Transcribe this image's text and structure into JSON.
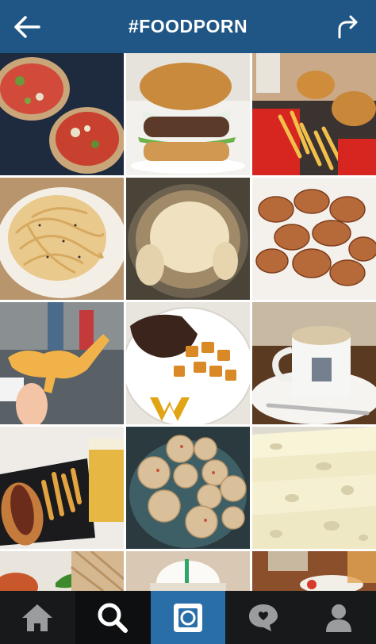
{
  "header": {
    "title": "#FOODPORN",
    "back_icon": "arrow-left-icon",
    "share_icon": "share-arrow-icon",
    "background": "#1f5685"
  },
  "grid": {
    "photos": [
      {
        "subject": "tacos",
        "row": 1,
        "col": 1
      },
      {
        "subject": "burger",
        "row": 1,
        "col": 2
      },
      {
        "subject": "fries-and-burgers",
        "row": 1,
        "col": 3
      },
      {
        "subject": "spaghetti",
        "row": 2,
        "col": 1
      },
      {
        "subject": "roast-chicken",
        "row": 2,
        "col": 2
      },
      {
        "subject": "potato-chips",
        "row": 2,
        "col": 3
      },
      {
        "subject": "dinosaur-cheese-puff",
        "row": 3,
        "col": 1
      },
      {
        "subject": "steak-and-potatoes",
        "row": 3,
        "col": 2
      },
      {
        "subject": "cappuccino",
        "row": 3,
        "col": 3
      },
      {
        "subject": "hot-dog-and-beer",
        "row": 4,
        "col": 1
      },
      {
        "subject": "fried-balls",
        "row": 4,
        "col": 2
      },
      {
        "subject": "swiss-cheese",
        "row": 4,
        "col": 3
      },
      {
        "subject": "salad-and-waffle",
        "row": 5,
        "col": 1
      },
      {
        "subject": "whipped-drink",
        "row": 5,
        "col": 2
      },
      {
        "subject": "table-setting",
        "row": 5,
        "col": 3
      }
    ]
  },
  "tabbar": {
    "tabs": [
      {
        "icon": "home-icon",
        "active": false
      },
      {
        "icon": "search-icon",
        "active": true
      },
      {
        "icon": "camera-icon",
        "active": false
      },
      {
        "icon": "activity-bubble-icon",
        "active": false
      },
      {
        "icon": "profile-icon",
        "active": false
      }
    ],
    "accent": "#2a6ea8"
  }
}
